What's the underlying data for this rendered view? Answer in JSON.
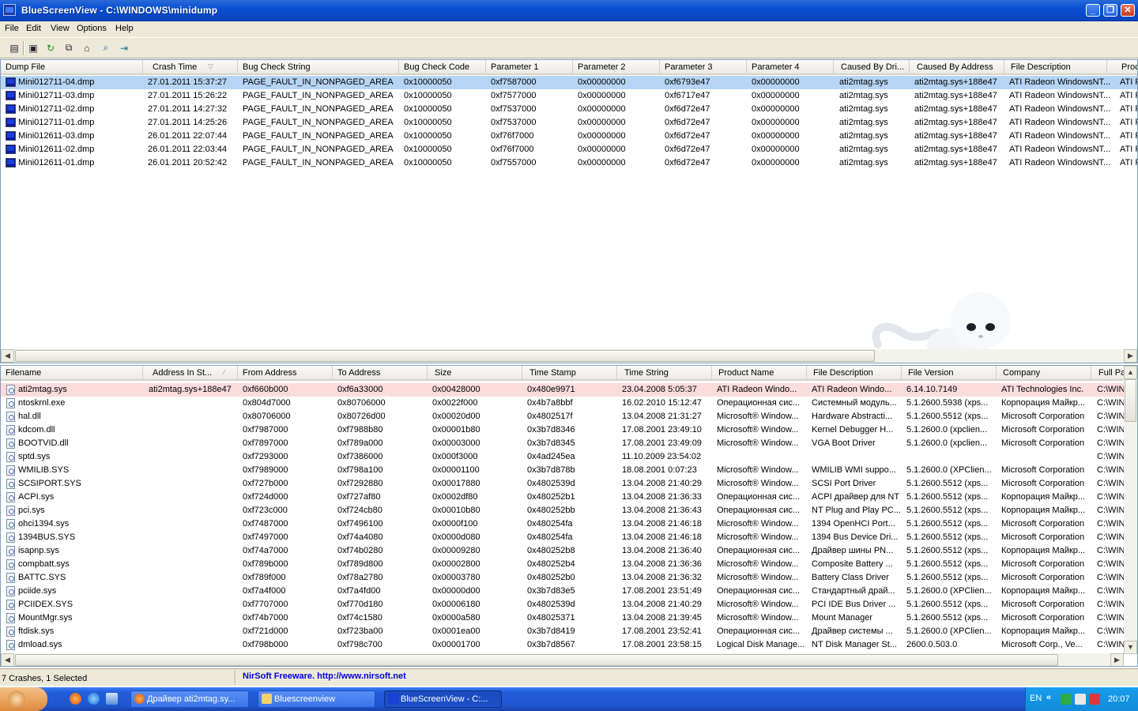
{
  "window": {
    "title": "BlueScreenView  -  C:\\WINDOWS\\minidump"
  },
  "menu": [
    "File",
    "Edit",
    "View",
    "Options",
    "Help"
  ],
  "toolbar": {
    "icons": [
      "properties-icon",
      "save-icon",
      "refresh-icon",
      "copy-icon",
      "html-report-icon",
      "find-icon",
      "exit-icon"
    ]
  },
  "top_table": {
    "columns": [
      "Dump File",
      "Crash Time",
      "Bug Check String",
      "Bug Check Code",
      "Parameter 1",
      "Parameter 2",
      "Parameter 3",
      "Parameter 4",
      "Caused By Dri...",
      "Caused By Address",
      "File Description",
      "Proc"
    ],
    "sorted_column": "Crash Time",
    "rows": [
      [
        "Mini012711-04.dmp",
        "27.01.2011 15:37:27",
        "PAGE_FAULT_IN_NONPAGED_AREA",
        "0x10000050",
        "0xf7587000",
        "0x00000000",
        "0xf6793e47",
        "0x00000000",
        "ati2mtag.sys",
        "ati2mtag.sys+188e47",
        "ATI Radeon WindowsNT...",
        "ATI R"
      ],
      [
        "Mini012711-03.dmp",
        "27.01.2011 15:26:22",
        "PAGE_FAULT_IN_NONPAGED_AREA",
        "0x10000050",
        "0xf7577000",
        "0x00000000",
        "0xf6717e47",
        "0x00000000",
        "ati2mtag.sys",
        "ati2mtag.sys+188e47",
        "ATI Radeon WindowsNT...",
        "ATI R"
      ],
      [
        "Mini012711-02.dmp",
        "27.01.2011 14:27:32",
        "PAGE_FAULT_IN_NONPAGED_AREA",
        "0x10000050",
        "0xf7537000",
        "0x00000000",
        "0xf6d72e47",
        "0x00000000",
        "ati2mtag.sys",
        "ati2mtag.sys+188e47",
        "ATI Radeon WindowsNT...",
        "ATI R"
      ],
      [
        "Mini012711-01.dmp",
        "27.01.2011 14:25:26",
        "PAGE_FAULT_IN_NONPAGED_AREA",
        "0x10000050",
        "0xf7537000",
        "0x00000000",
        "0xf6d72e47",
        "0x00000000",
        "ati2mtag.sys",
        "ati2mtag.sys+188e47",
        "ATI Radeon WindowsNT...",
        "ATI R"
      ],
      [
        "Mini012611-03.dmp",
        "26.01.2011 22:07:44",
        "PAGE_FAULT_IN_NONPAGED_AREA",
        "0x10000050",
        "0xf76f7000",
        "0x00000000",
        "0xf6d72e47",
        "0x00000000",
        "ati2mtag.sys",
        "ati2mtag.sys+188e47",
        "ATI Radeon WindowsNT...",
        "ATI R"
      ],
      [
        "Mini012611-02.dmp",
        "26.01.2011 22:03:44",
        "PAGE_FAULT_IN_NONPAGED_AREA",
        "0x10000050",
        "0xf76f7000",
        "0x00000000",
        "0xf6d72e47",
        "0x00000000",
        "ati2mtag.sys",
        "ati2mtag.sys+188e47",
        "ATI Radeon WindowsNT...",
        "ATI R"
      ],
      [
        "Mini012611-01.dmp",
        "26.01.2011 20:52:42",
        "PAGE_FAULT_IN_NONPAGED_AREA",
        "0x10000050",
        "0xf7557000",
        "0x00000000",
        "0xf6d72e47",
        "0x00000000",
        "ati2mtag.sys",
        "ati2mtag.sys+188e47",
        "ATI Radeon WindowsNT...",
        "ATI R"
      ]
    ]
  },
  "bottom_table": {
    "columns": [
      "Filename",
      "Address In St...",
      "From Address",
      "To Address",
      "Size",
      "Time Stamp",
      "Time String",
      "Product Name",
      "File Description",
      "File Version",
      "Company",
      "Full Pat"
    ],
    "rows": [
      [
        "ati2mtag.sys",
        "ati2mtag.sys+188e47",
        "0xf660b000",
        "0xf6a33000",
        "0x00428000",
        "0x480e9971",
        "23.04.2008 5:05:37",
        "ATI Radeon Windo...",
        "ATI Radeon Windo...",
        "6.14.10.7149",
        "ATI Technologies Inc.",
        "C:\\WIN"
      ],
      [
        "ntoskrnl.exe",
        "",
        "0x804d7000",
        "0x80706000",
        "0x0022f000",
        "0x4b7a8bbf",
        "16.02.2010 15:12:47",
        "Операционная сис...",
        "Системный модуль...",
        "5.1.2600.5938 (xps...",
        "Корпорация Майкр...",
        "C:\\WIN"
      ],
      [
        "hal.dll",
        "",
        "0x80706000",
        "0x80726d00",
        "0x00020d00",
        "0x4802517f",
        "13.04.2008 21:31:27",
        "Microsoft® Window...",
        "Hardware Abstracti...",
        "5.1.2600.5512 (xps...",
        "Microsoft Corporation",
        "C:\\WIN"
      ],
      [
        "kdcom.dll",
        "",
        "0xf7987000",
        "0xf7988b80",
        "0x00001b80",
        "0x3b7d8346",
        "17.08.2001 23:49:10",
        "Microsoft® Window...",
        "Kernel Debugger H...",
        "5.1.2600.0 (xpclien...",
        "Microsoft Corporation",
        "C:\\WIN"
      ],
      [
        "BOOTVID.dll",
        "",
        "0xf7897000",
        "0xf789a000",
        "0x00003000",
        "0x3b7d8345",
        "17.08.2001 23:49:09",
        "Microsoft® Window...",
        "VGA Boot Driver",
        "5.1.2600.0 (xpclien...",
        "Microsoft Corporation",
        "C:\\WIN"
      ],
      [
        "sptd.sys",
        "",
        "0xf7293000",
        "0xf7386000",
        "0x000f3000",
        "0x4ad245ea",
        "11.10.2009 23:54:02",
        "",
        "",
        "",
        "",
        "C:\\WIN"
      ],
      [
        "WMILIB.SYS",
        "",
        "0xf7989000",
        "0xf798a100",
        "0x00001100",
        "0x3b7d878b",
        "18.08.2001 0:07:23",
        "Microsoft® Window...",
        "WMILIB WMI suppo...",
        "5.1.2600.0 (XPClien...",
        "Microsoft Corporation",
        "C:\\WIN"
      ],
      [
        "SCSIPORT.SYS",
        "",
        "0xf727b000",
        "0xf7292880",
        "0x00017880",
        "0x4802539d",
        "13.04.2008 21:40:29",
        "Microsoft® Window...",
        "SCSI Port Driver",
        "5.1.2600.5512 (xps...",
        "Microsoft Corporation",
        "C:\\WIN"
      ],
      [
        "ACPI.sys",
        "",
        "0xf724d000",
        "0xf727af80",
        "0x0002df80",
        "0x480252b1",
        "13.04.2008 21:36:33",
        "Операционная сис...",
        "ACPI драйвер для NT",
        "5.1.2600.5512 (xps...",
        "Корпорация Майкр...",
        "C:\\WIN"
      ],
      [
        "pci.sys",
        "",
        "0xf723c000",
        "0xf724cb80",
        "0x00010b80",
        "0x480252bb",
        "13.04.2008 21:36:43",
        "Операционная сис...",
        "NT Plug and Play PC...",
        "5.1.2600.5512 (xps...",
        "Корпорация Майкр...",
        "C:\\WIN"
      ],
      [
        "ohci1394.sys",
        "",
        "0xf7487000",
        "0xf7496100",
        "0x0000f100",
        "0x480254fa",
        "13.04.2008 21:46:18",
        "Microsoft® Window...",
        "1394 OpenHCI Port...",
        "5.1.2600.5512 (xps...",
        "Microsoft Corporation",
        "C:\\WIN"
      ],
      [
        "1394BUS.SYS",
        "",
        "0xf7497000",
        "0xf74a4080",
        "0x0000d080",
        "0x480254fa",
        "13.04.2008 21:46:18",
        "Microsoft® Window...",
        "1394 Bus Device Dri...",
        "5.1.2600.5512 (xps...",
        "Microsoft Corporation",
        "C:\\WIN"
      ],
      [
        "isapnp.sys",
        "",
        "0xf74a7000",
        "0xf74b0280",
        "0x00009280",
        "0x480252b8",
        "13.04.2008 21:36:40",
        "Операционная сис...",
        "Драйвер шины PN...",
        "5.1.2600.5512 (xps...",
        "Корпорация Майкр...",
        "C:\\WIN"
      ],
      [
        "compbatt.sys",
        "",
        "0xf789b000",
        "0xf789d800",
        "0x00002800",
        "0x480252b4",
        "13.04.2008 21:36:36",
        "Microsoft® Window...",
        "Composite Battery ...",
        "5.1.2600.5512 (xps...",
        "Microsoft Corporation",
        "C:\\WIN"
      ],
      [
        "BATTC.SYS",
        "",
        "0xf789f000",
        "0xf78a2780",
        "0x00003780",
        "0x480252b0",
        "13.04.2008 21:36:32",
        "Microsoft® Window...",
        "Battery Class Driver",
        "5.1.2600.5512 (xps...",
        "Microsoft Corporation",
        "C:\\WIN"
      ],
      [
        "pciide.sys",
        "",
        "0xf7a4f000",
        "0xf7a4fd00",
        "0x00000d00",
        "0x3b7d83e5",
        "17.08.2001 23:51:49",
        "Операционная сис...",
        "Стандартный драй...",
        "5.1.2600.0 (XPClien...",
        "Корпорация Майкр...",
        "C:\\WIN"
      ],
      [
        "PCIIDEX.SYS",
        "",
        "0xf7707000",
        "0xf770d180",
        "0x00006180",
        "0x4802539d",
        "13.04.2008 21:40:29",
        "Microsoft® Window...",
        "PCI IDE Bus Driver ...",
        "5.1.2600.5512 (xps...",
        "Microsoft Corporation",
        "C:\\WIN"
      ],
      [
        "MountMgr.sys",
        "",
        "0xf74b7000",
        "0xf74c1580",
        "0x0000a580",
        "0x48025371",
        "13.04.2008 21:39:45",
        "Microsoft® Window...",
        "Mount Manager",
        "5.1.2600.5512 (xps...",
        "Microsoft Corporation",
        "C:\\WIN"
      ],
      [
        "ftdisk.sys",
        "",
        "0xf721d000",
        "0xf723ba00",
        "0x0001ea00",
        "0x3b7d8419",
        "17.08.2001 23:52:41",
        "Операционная сис...",
        "Драйвер системы ...",
        "5.1.2600.0 (XPClien...",
        "Корпорация Майкр...",
        "C:\\WIN"
      ],
      [
        "dmload.sys",
        "",
        "0xf798b000",
        "0xf798c700",
        "0x00001700",
        "0x3b7d8567",
        "17.08.2001 23:58:15",
        "Logical Disk Manage...",
        "NT Disk Manager St...",
        "2600.0.503.0",
        "Microsoft Corp., Ve...",
        "C:\\WIN"
      ]
    ]
  },
  "status": {
    "count_text": "7 Crashes, 1 Selected",
    "link_text": "NirSoft Freeware.  http://www.nirsoft.net"
  },
  "taskbar": {
    "tasks": [
      "Драйвер ati2mtag.sy...",
      "Bluescreenview",
      "BlueScreenView  -  C:..."
    ],
    "language": "EN",
    "clock": "20:07"
  },
  "colors": {
    "selected_row": "#b6d5f4",
    "highlight_row": "#fbdcdc",
    "link": "#0000e0",
    "titlebar": "#0a4fd1"
  }
}
